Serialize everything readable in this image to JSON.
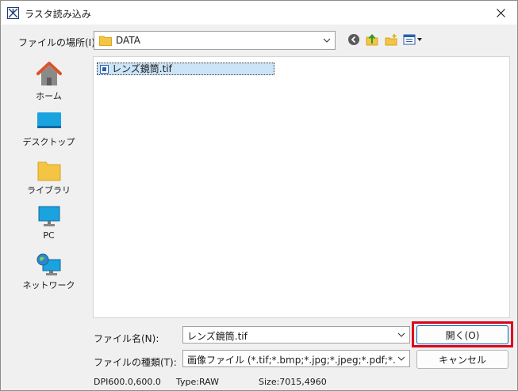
{
  "window": {
    "title": "ラスタ読み込み",
    "close_icon": "close-icon"
  },
  "location": {
    "label": "ファイルの場所(I):",
    "value": "DATA",
    "folder_icon": "folder-icon"
  },
  "toolbar": {
    "back_icon": "back-icon",
    "up_icon": "up-folder-icon",
    "new_folder_icon": "new-folder-icon",
    "view_menu_icon": "view-menu-icon"
  },
  "places": [
    {
      "label": "ホーム",
      "icon": "home-icon"
    },
    {
      "label": "デスクトップ",
      "icon": "desktop-icon"
    },
    {
      "label": "ライブラリ",
      "icon": "library-icon"
    },
    {
      "label": "PC",
      "icon": "pc-icon"
    },
    {
      "label": "ネットワーク",
      "icon": "network-icon"
    }
  ],
  "files": [
    {
      "name": "レンズ鏡筒.tif",
      "icon": "image-file-icon",
      "selected": true
    }
  ],
  "filename": {
    "label": "ファイル名(N):",
    "value": "レンズ鏡筒.tif"
  },
  "filetype": {
    "label": "ファイルの種類(T):",
    "value": "画像ファイル (*.tif;*.bmp;*.jpg;*.jpeg;*.pdf;*.sci;*.cal;"
  },
  "buttons": {
    "open": "開く(O)",
    "cancel": "キャンセル"
  },
  "status": {
    "dpi": "DPI600.0,600.0",
    "type": "Type:RAW",
    "size": "Size:7015,4960"
  },
  "colors": {
    "highlight": "#e0001a",
    "selection": "#cce4f7",
    "folder": "#f4c443"
  }
}
